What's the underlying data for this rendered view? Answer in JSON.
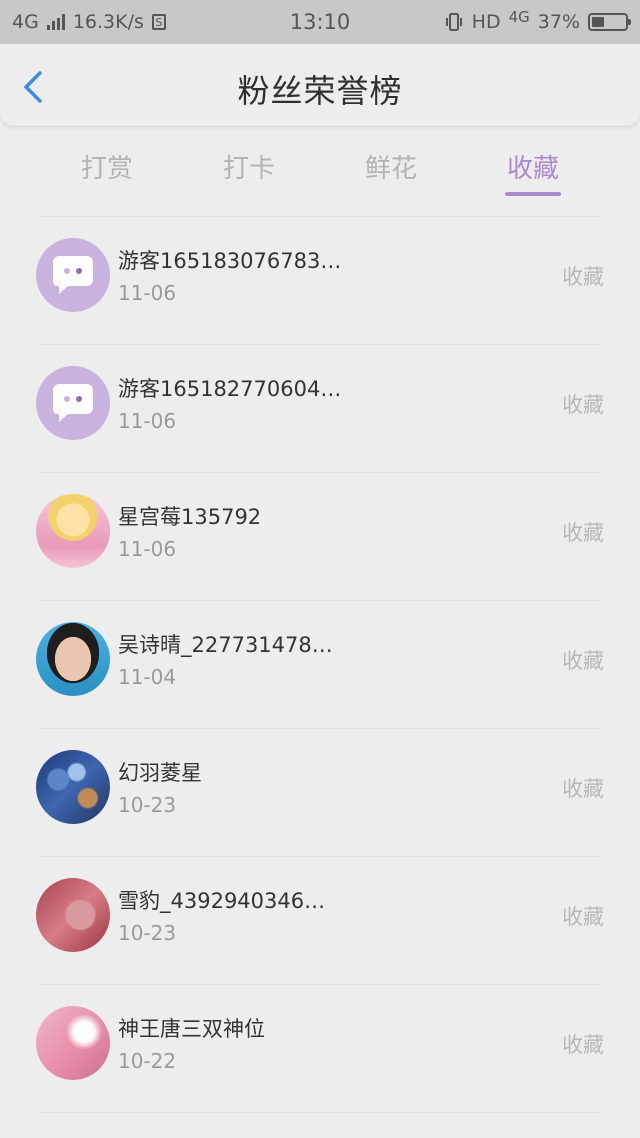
{
  "status": {
    "network": "4G",
    "speed": "16.3K/s",
    "time": "13:10",
    "hd": "HD",
    "network2": "4G",
    "battery": "37%",
    "battery_level": 0.37
  },
  "header": {
    "title": "粉丝荣誉榜"
  },
  "tabs": [
    {
      "label": "打赏",
      "active": false
    },
    {
      "label": "打卡",
      "active": false
    },
    {
      "label": "鲜花",
      "active": false
    },
    {
      "label": "收藏",
      "active": true
    }
  ],
  "rows": [
    {
      "name": "游客165183076783…",
      "date": "11-06",
      "action": "收藏",
      "avatar": "guest-chat-icon"
    },
    {
      "name": "游客165182770604…",
      "date": "11-06",
      "action": "收藏",
      "avatar": "guest-chat-icon"
    },
    {
      "name": "星宫莓135792",
      "date": "11-06",
      "action": "收藏",
      "avatar": "anime-girl-photo"
    },
    {
      "name": "吴诗晴_227731478…",
      "date": "11-04",
      "action": "收藏",
      "avatar": "portrait-photo"
    },
    {
      "name": "幻羽菱星",
      "date": "10-23",
      "action": "收藏",
      "avatar": "blue-scene-photo"
    },
    {
      "name": "雪豹_4392940346…",
      "date": "10-23",
      "action": "收藏",
      "avatar": "banknote-photo"
    },
    {
      "name": "神王唐三双神位",
      "date": "10-22",
      "action": "收藏",
      "avatar": "pink-art-photo"
    }
  ],
  "colors": {
    "accent": "#a98cc9",
    "avatar_icon_bg": "#c8b3df"
  }
}
